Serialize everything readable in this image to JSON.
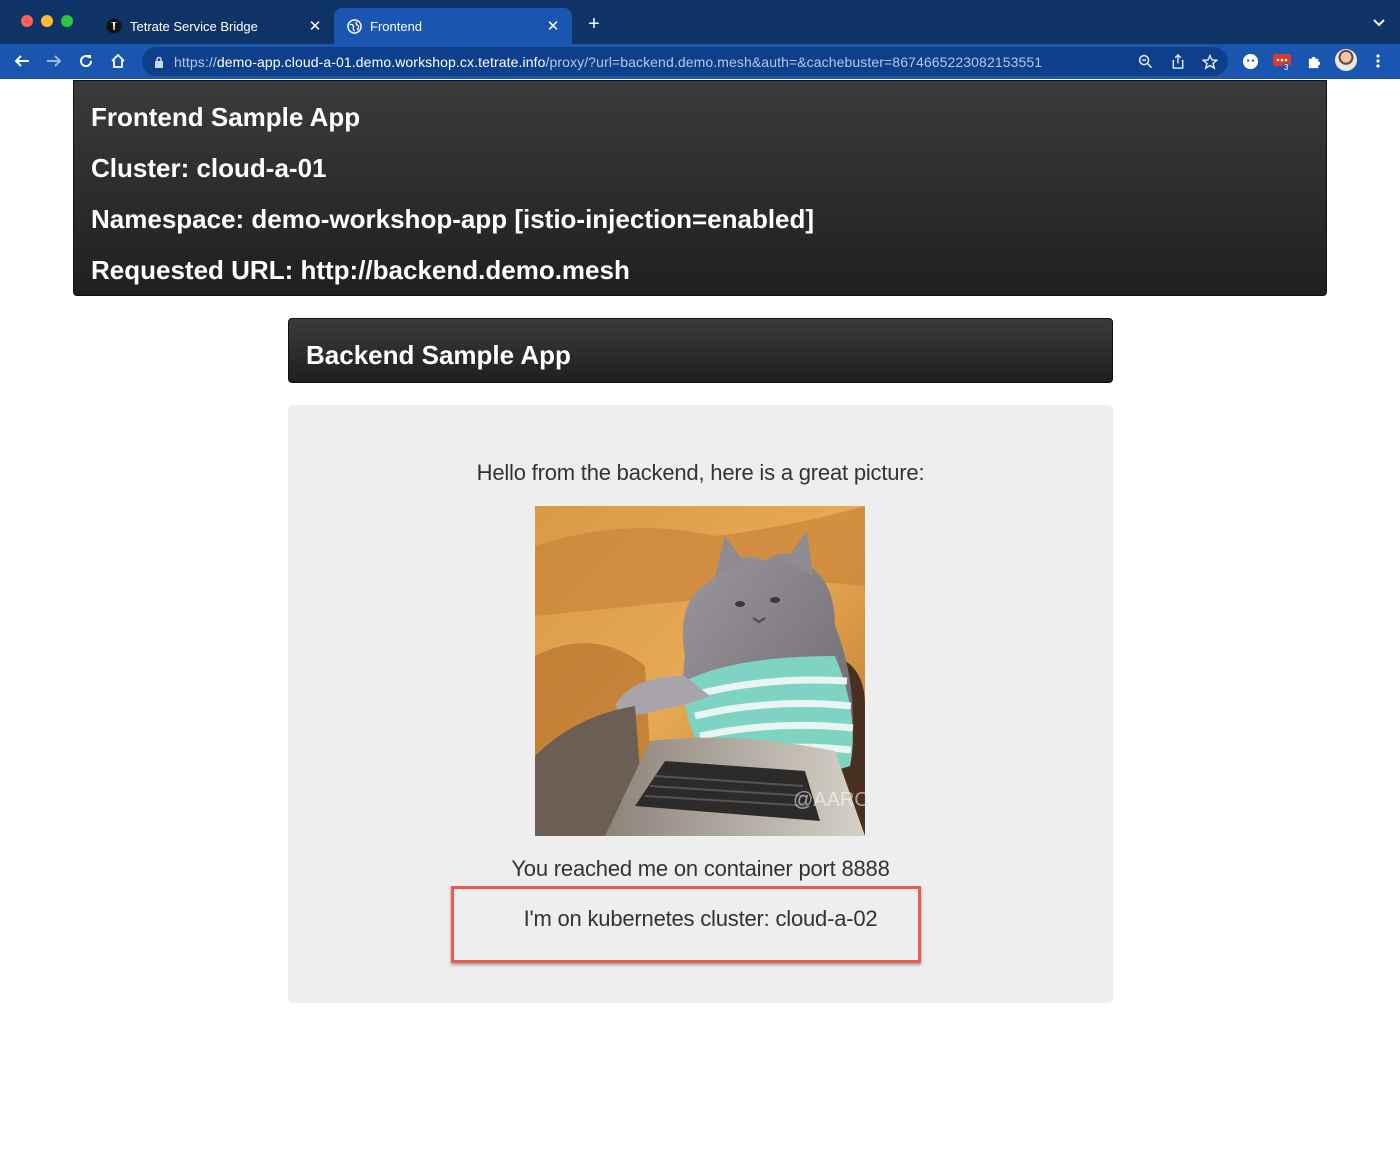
{
  "browser": {
    "tabs": [
      {
        "title": "Tetrate Service Bridge",
        "icon": "tetrate-logo-icon",
        "active": false
      },
      {
        "title": "Frontend",
        "icon": "globe-icon",
        "active": true
      }
    ],
    "url_scheme": "https://",
    "url_host": "demo-app.cloud-a-01.demo.workshop.cx.tetrate.info",
    "url_path": "/proxy/?url=backend.demo.mesh&auth=&cachebuster=8674665223082153551",
    "extension_badge": "3",
    "colors": {
      "tabstrip": "#0f3366",
      "toolbar": "#1a56b0",
      "omnibox": "#0d3f8a"
    }
  },
  "frontend": {
    "title": "Frontend Sample App",
    "cluster": "Cluster: cloud-a-01",
    "namespace": "Namespace: demo-workshop-app [istio-injection=enabled]",
    "requested_url": "Requested URL: http://backend.demo.mesh"
  },
  "backend": {
    "title": "Backend Sample App",
    "greeting": "Hello from the backend, here is a great picture:",
    "image_watermark": "@AARON",
    "port_message": "You reached me on container port 8888",
    "cluster_message": "I'm on kubernetes cluster: cloud-a-02",
    "highlight_color": "#ee5a4f"
  }
}
